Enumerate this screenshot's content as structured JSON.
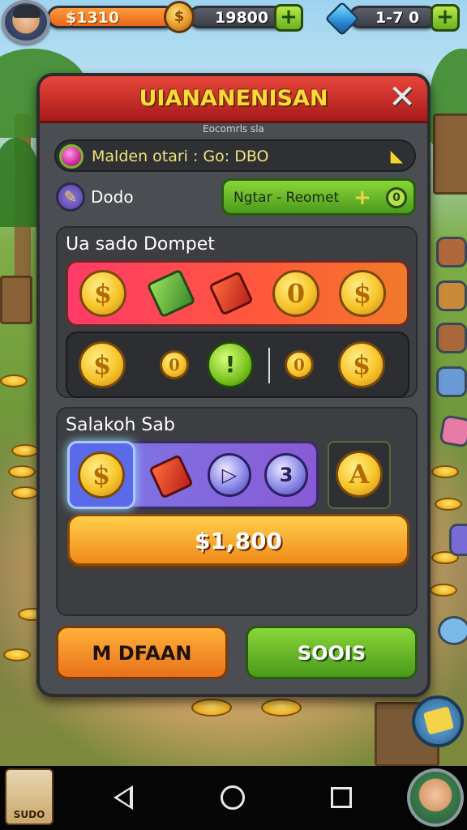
{
  "hud": {
    "money": "$1310",
    "gold_coin_symbol": "$",
    "gold": "19800",
    "gems": "1-7 0",
    "plus": "+",
    "icons": [
      "avatar-icon",
      "coin-icon",
      "gem-icon",
      "plus-icon"
    ]
  },
  "modal": {
    "title": "UIANANENISAN",
    "close": "✕",
    "subtitle": "Eocomrls sla",
    "info_text": "Malden otari : Go: DBO",
    "info_arrow": "◣",
    "dodo_label": "Dodo",
    "dodo_icon_glyph": "✎",
    "green_button": {
      "label": "Ngtar - Reomet",
      "plus": "+",
      "coin": "0"
    },
    "section1": {
      "title": "Ua sado Dompet",
      "top_row": [
        "$",
        "box",
        "box",
        "0",
        "$"
      ],
      "bottom_row": [
        "$",
        "0",
        "!",
        "0",
        "$"
      ]
    },
    "section2": {
      "title": "Salakoh Sab",
      "row": [
        "$",
        "box",
        "▷",
        "3",
        "A"
      ],
      "price": "$1,800"
    },
    "btn_left": "M DFAAN",
    "btn_right": "SOOIS"
  },
  "nav": {
    "sudo_label": "SUDO",
    "buttons": [
      "back",
      "home",
      "recents"
    ]
  },
  "colors": {
    "header_red": "#d8322a",
    "title_gold": "#ffd83a",
    "orange": "#f08a1a",
    "green": "#6ab21e",
    "panel": "#4a4d52"
  }
}
